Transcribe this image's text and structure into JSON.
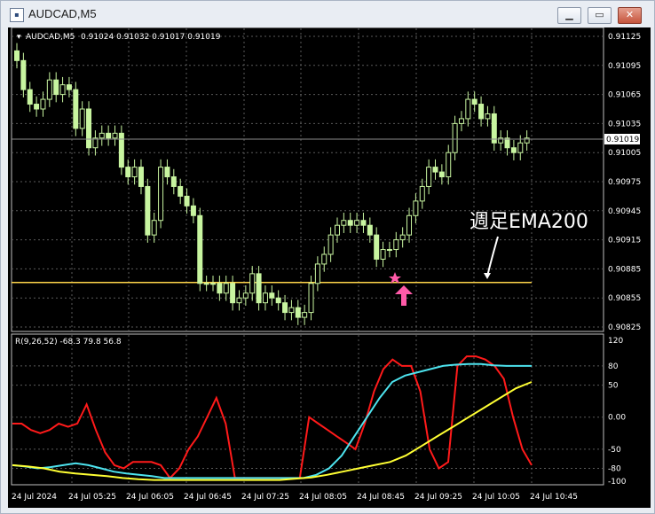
{
  "window": {
    "title": "AUDCAD,M5",
    "min_glyph": "▁",
    "restore_glyph": "▭",
    "close_glyph": "✕"
  },
  "main": {
    "symbol_label": "AUDCAD,M5",
    "ohlc": "0.91024 0.91032 0.91017 0.91019",
    "current_price": "0.91019",
    "price_ticks": [
      "0.91125",
      "0.91095",
      "0.91065",
      "0.91035",
      "0.91005",
      "0.90975",
      "0.90945",
      "0.90915",
      "0.90885",
      "0.90855",
      "0.90825"
    ],
    "annotation": "週足EMA200",
    "ema_level": 0.90871
  },
  "indicator": {
    "label": "R(9,26,52) -68.3 79.8 56.8",
    "ticks": [
      "120",
      "80",
      "50",
      "0.00",
      "-50",
      "-80",
      "-100"
    ]
  },
  "time_ticks": [
    "24 Jul 2024",
    "24 Jul 05:25",
    "24 Jul 06:05",
    "24 Jul 06:45",
    "24 Jul 07:25",
    "24 Jul 08:05",
    "24 Jul 08:45",
    "24 Jul 09:25",
    "24 Jul 10:05",
    "24 Jul 10:45"
  ],
  "colors": {
    "background": "#000000",
    "candle": "#c8f5a0",
    "ema_line": "#ffd54a",
    "red_line": "#ff1a1a",
    "cyan_line": "#4de3ee",
    "yellow_line": "#ffff33",
    "marker": "#ff5aa8"
  },
  "chart_data": {
    "type": "candlestick",
    "candles_close": [
      0.911,
      0.9107,
      0.91055,
      0.9105,
      0.9106,
      0.9108,
      0.91065,
      0.91075,
      0.9107,
      0.9103,
      0.9105,
      0.9101,
      0.9102,
      0.91025,
      0.9102,
      0.91025,
      0.9099,
      0.9098,
      0.9099,
      0.9097,
      0.9092,
      0.90935,
      0.9099,
      0.9098,
      0.9097,
      0.9096,
      0.9095,
      0.9094,
      0.9087,
      0.9087,
      0.9087,
      0.9086,
      0.9087,
      0.9085,
      0.90855,
      0.9086,
      0.9088,
      0.9085,
      0.9086,
      0.90855,
      0.9085,
      0.9084,
      0.90845,
      0.90835,
      0.9084,
      0.9087,
      0.9089,
      0.909,
      0.9092,
      0.9093,
      0.90935,
      0.9093,
      0.90935,
      0.9093,
      0.9092,
      0.90895,
      0.90905,
      0.90905,
      0.90915,
      0.9092,
      0.9094,
      0.90955,
      0.9097,
      0.9099,
      0.90985,
      0.9098,
      0.91005,
      0.91035,
      0.9104,
      0.9106,
      0.91055,
      0.9104,
      0.91045,
      0.91015,
      0.9102,
      0.9101,
      0.91005,
      0.91015,
      0.9102
    ],
    "indicator_series": [
      {
        "color": "red",
        "values": [
          -10,
          -10,
          -20,
          -25,
          -20,
          -10,
          -15,
          -10,
          20,
          -20,
          -55,
          -75,
          -80,
          -70,
          -70,
          -70,
          -75,
          -95,
          -80,
          -50,
          -30,
          0,
          30,
          -10,
          -95,
          -95,
          -95,
          -95,
          -95,
          -95,
          -95,
          -95,
          0,
          -10,
          -20,
          -30,
          -40,
          -50,
          -10,
          40,
          75,
          90,
          80,
          80,
          40,
          -50,
          -80,
          -70,
          80,
          95,
          95,
          90,
          80,
          60,
          0,
          -50,
          -75
        ]
      },
      {
        "color": "cyan",
        "values": [
          -75,
          -77,
          -80,
          -78,
          -75,
          -72,
          -75,
          -80,
          -85,
          -88,
          -90,
          -92,
          -95,
          -95,
          -95,
          -95,
          -95,
          -95,
          -95,
          -95,
          -95,
          -95,
          -95,
          -95,
          -90,
          -80,
          -60,
          -30,
          0,
          30,
          55,
          65,
          70,
          75,
          80,
          82,
          83,
          83,
          81,
          80,
          80,
          80
        ]
      },
      {
        "color": "yellow",
        "values": [
          -75,
          -77,
          -80,
          -85,
          -88,
          -90,
          -92,
          -95,
          -97,
          -98,
          -98,
          -98,
          -98,
          -98,
          -98,
          -98,
          -98,
          -98,
          -96,
          -94,
          -90,
          -85,
          -80,
          -75,
          -70,
          -60,
          -45,
          -30,
          -15,
          0,
          15,
          30,
          45,
          55
        ]
      }
    ]
  }
}
